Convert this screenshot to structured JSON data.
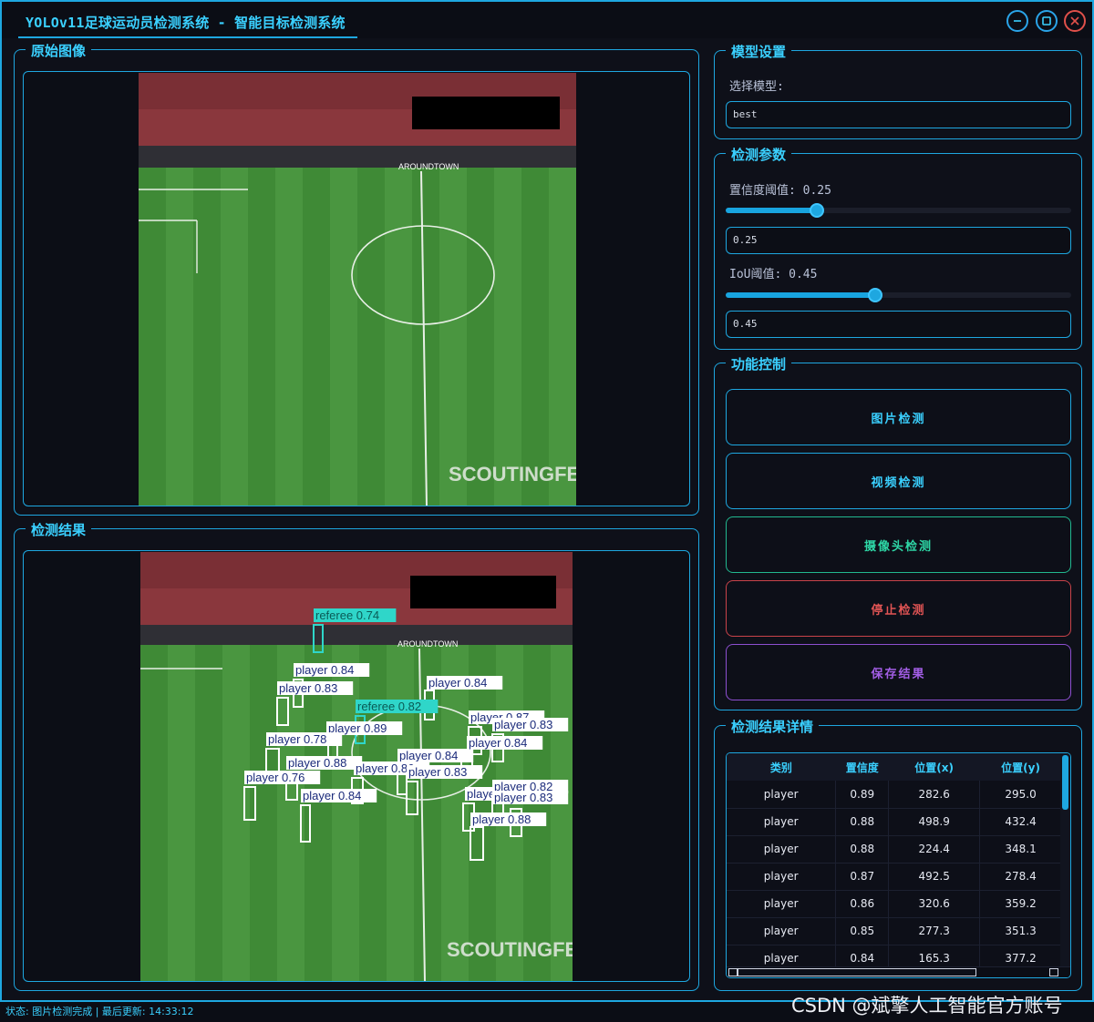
{
  "window": {
    "title": "YOLOv11足球运动员检测系统 - 智能目标检测系统"
  },
  "panels": {
    "original": {
      "title": "原始图像"
    },
    "result": {
      "title": "检测结果"
    }
  },
  "photo": {
    "watermark": "SCOUTINGFEED",
    "banner": "AROUNDTOWN"
  },
  "model_settings": {
    "title": "模型设置",
    "select_label": "选择模型:",
    "selected_model": "best"
  },
  "params": {
    "title": "检测参数",
    "conf_label": "置信度阈值: 0.25",
    "conf_value": "0.25",
    "conf_level": 0.25,
    "iou_label": "IoU阈值: 0.45",
    "iou_value": "0.45",
    "iou_level": 0.45
  },
  "controls": {
    "title": "功能控制",
    "image_detect": "图片检测",
    "video_detect": "视频检测",
    "camera_detect": "摄像头检测",
    "stop_detect": "停止检测",
    "save_result": "保存结果"
  },
  "details": {
    "title": "检测结果详情",
    "columns": [
      "类别",
      "置信度",
      "位置(x)",
      "位置(y)"
    ],
    "rows": [
      [
        "player",
        "0.89",
        "282.6",
        "295.0"
      ],
      [
        "player",
        "0.88",
        "498.9",
        "432.4"
      ],
      [
        "player",
        "0.88",
        "224.4",
        "348.1"
      ],
      [
        "player",
        "0.87",
        "492.5",
        "278.4"
      ],
      [
        "player",
        "0.86",
        "320.6",
        "359.2"
      ],
      [
        "player",
        "0.85",
        "277.3",
        "351.3"
      ],
      [
        "player",
        "0.84",
        "165.3",
        "377.2"
      ]
    ]
  },
  "detections": [
    {
      "label": "referee 0.74",
      "cls": "referee"
    },
    {
      "label": "player 0.84",
      "cls": "player"
    },
    {
      "label": "player 0.83",
      "cls": "player"
    },
    {
      "label": "player 0.84",
      "cls": "player"
    },
    {
      "label": "referee 0.82",
      "cls": "referee"
    },
    {
      "label": "player 0.89",
      "cls": "player"
    },
    {
      "label": "player 0.87",
      "cls": "player"
    },
    {
      "label": "player 0.83",
      "cls": "player"
    },
    {
      "label": "player 0.78",
      "cls": "player"
    },
    {
      "label": "player 0.84",
      "cls": "player"
    },
    {
      "label": "player 0.88",
      "cls": "player"
    },
    {
      "label": "player 0.84",
      "cls": "player"
    },
    {
      "label": "player 0.86",
      "cls": "player"
    },
    {
      "label": "player 0.83",
      "cls": "player"
    },
    {
      "label": "player 0.84",
      "cls": "player"
    },
    {
      "label": "player 0.76",
      "cls": "player"
    },
    {
      "label": "player 0.84",
      "cls": "player"
    },
    {
      "label": "player 0.82",
      "cls": "player"
    },
    {
      "label": "player 0.83",
      "cls": "player"
    },
    {
      "label": "player 0.88",
      "cls": "player"
    }
  ],
  "status": {
    "text": "状态: 图片检测完成 | 最后更新: 14:33:12"
  },
  "watermark": "CSDN @斌擎人工智能官方账号",
  "colors": {
    "accent": "#1ea7e0",
    "player_box": "#ffffff",
    "referee_box": "#2fd6c9",
    "stop": "#e05454",
    "save": "#a35ee6",
    "camera": "#2ed8a7"
  }
}
